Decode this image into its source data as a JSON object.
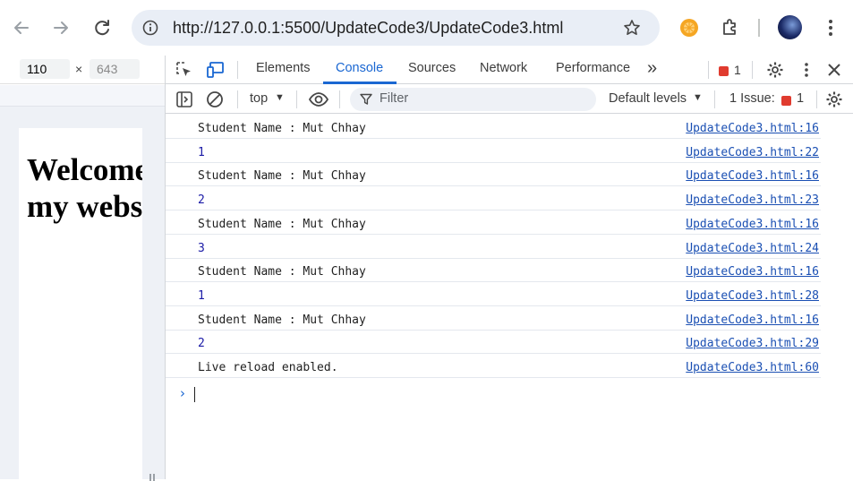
{
  "browser": {
    "url": "http://127.0.0.1:5500/UpdateCode3/UpdateCode3.html",
    "colors": {
      "accent": "#1a67d2",
      "error": "#e03b2f",
      "omnibox": "#e9eef6"
    }
  },
  "device": {
    "width": "110",
    "height_placeholder": "643",
    "separator": "×"
  },
  "page": {
    "heading": "Welcome to my website!"
  },
  "devtools": {
    "tabs": [
      {
        "label": "Elements"
      },
      {
        "label": "Console"
      },
      {
        "label": "Sources"
      },
      {
        "label": "Network"
      },
      {
        "label": "Performance"
      }
    ],
    "more_tabs": "»",
    "error_count": "1",
    "context": "top",
    "filter_placeholder": "Filter",
    "levels": "Default levels",
    "issues_label": "1 Issue:",
    "issues_count": "1"
  },
  "console": {
    "rows": [
      {
        "msg": "Student Name : Mut Chhay",
        "src": "UpdateCode3.html:16"
      },
      {
        "msg": "1",
        "src": "UpdateCode3.html:22"
      },
      {
        "msg": "Student Name : Mut Chhay",
        "src": "UpdateCode3.html:16"
      },
      {
        "msg": "2",
        "src": "UpdateCode3.html:23"
      },
      {
        "msg": "Student Name : Mut Chhay",
        "src": "UpdateCode3.html:16"
      },
      {
        "msg": "3",
        "src": "UpdateCode3.html:24"
      },
      {
        "msg": "Student Name : Mut Chhay",
        "src": "UpdateCode3.html:16"
      },
      {
        "msg": "1",
        "src": "UpdateCode3.html:28"
      },
      {
        "msg": "Student Name : Mut Chhay",
        "src": "UpdateCode3.html:16"
      },
      {
        "msg": "2",
        "src": "UpdateCode3.html:29"
      },
      {
        "msg": "Live reload enabled.",
        "src": "UpdateCode3.html:60"
      }
    ],
    "prompt": "›"
  }
}
